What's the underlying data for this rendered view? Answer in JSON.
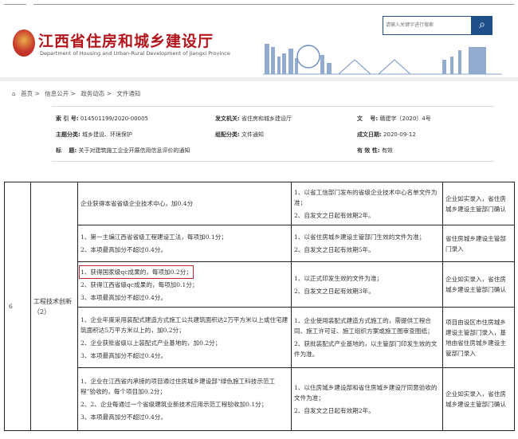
{
  "header": {
    "title": "江西省住房和城乡建设厅",
    "subtitle": "Department of Housing and Urban-Rural Development of Jiangxi Province",
    "search_placeholder": "请输入关键字进行搜索",
    "search_icon": "magnifier-icon"
  },
  "breadcrumb": [
    "首页 >",
    "信息公开 >",
    "政务动态 >",
    "文件通知"
  ],
  "info": {
    "index_label": "索 引 号:",
    "index": "014501199/2020-00005",
    "issuer_label": "发文机关:",
    "issuer": "省住房和城乡建设厅",
    "docno_label": "文　 号:",
    "docno": "赣建字〔2020〕4号",
    "topic_label": "主题分类:",
    "topic": "城乡建设、环境保护",
    "category_label": "组配分类:",
    "category": "文件通知",
    "date_label": "成文日期:",
    "date": "2020-09-12",
    "title_label": "标　 题:",
    "title": "关于对建筑施工企业开展信用信息评价的通知",
    "validity_label": "有 效 性:",
    "validity": "有效"
  },
  "table": {
    "num": "6",
    "category": "工程技术创新（2）",
    "rows": [
      {
        "criteria": [
          "企业获得本省省级企业技术中心，加0.4分"
        ],
        "basis": [
          "1、以省工信部门发布的省级企业技术中心名单文件为准；",
          "2、自发文之日起有效期2年。"
        ],
        "entry": "企业如实录入，省住房城乡建设主管部门确认"
      },
      {
        "criteria": [
          "1、第一主编江西省省级工程建设工法，每项加0.1分；",
          "2、本项最高加分不超过0.4分。"
        ],
        "basis": [
          "1、以省住房城乡建设主管部门生效的文件为准；",
          "2、自发文之日起有效期5年。"
        ],
        "entry": "省住房城乡建设主管部门录入"
      },
      {
        "criteria": [
          "1、获得国家级qc成果的，每项加0.2分；",
          "2、获得江西省级qc成果的，每项加0.1分；",
          "3、本项最高加分不超过0.4分。"
        ],
        "basis": [
          "1、以正式印发生效的文件为准；",
          "2、自发文之日起有效期3年。"
        ],
        "entry": "企业如实录入，省住房城乡建设主管部门确认",
        "highlight": 0
      },
      {
        "criteria": [
          "1、企业年度采用装配式建造方式施工公共建筑面积达2万平方米以上或住宅建筑面积达5万平方米以上的，加0.2分；",
          "2、企业获批省级以上装配式产业基地的，加0.2分；",
          "3、本项最高加分不超过0.4分。"
        ],
        "basis": [
          "1、企业使用装配式建造方式施工的，需提供工程合同、施工许可证、施工组织方案或施工图审查图纸；",
          "2、获批装配式产业基地的，以主管部门印发生效的文件为准。"
        ],
        "entry": "项目由设区市住房城乡建设主管部门录入，基地由省住房城乡建设主管部门录入"
      },
      {
        "criteria": [
          "1、企业在江西省内承接的项目通过住房城乡建设部“绿色施工科技示范工程”验收的，每个项目加0.2分；",
          "2、2、企业每通过一个省级建筑业新技术应用示范工程验收加0.1分；",
          "3、本项最高加分不超过0.4分。"
        ],
        "basis": [
          "1、以住房城乡建设部和省住房城乡建设厅同意验收的文件为准；",
          "2、自发文之日起有效期2年。"
        ],
        "entry": "企业如实录入，省住房城乡建设主管部门确认"
      }
    ]
  }
}
